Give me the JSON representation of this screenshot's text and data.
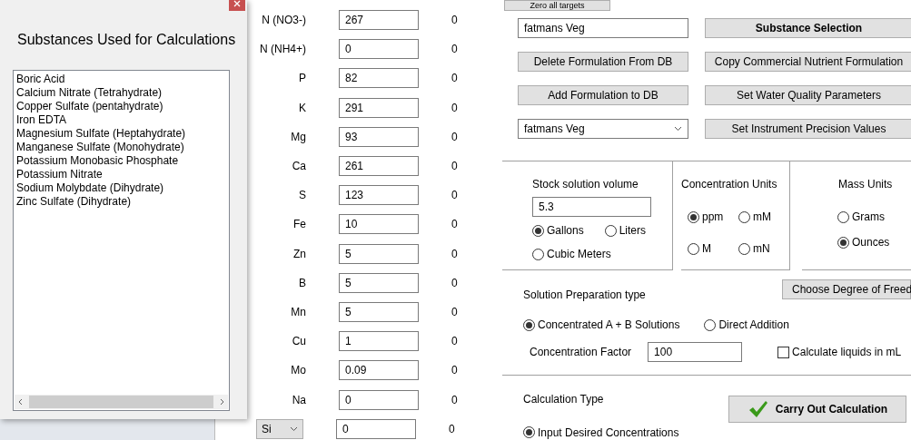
{
  "substances_dialog": {
    "title": "Substances Used for Calculations",
    "items": [
      "Boric Acid",
      "Calcium Nitrate (Tetrahydrate)",
      "Copper Sulfate (pentahydrate)",
      "Iron EDTA",
      "Magnesium Sulfate (Heptahydrate)",
      "Manganese Sulfate (Monohydrate)",
      "Potassium Monobasic Phosphate",
      "Potassium Nitrate",
      "Sodium Molybdate (Dihydrate)",
      "Zinc Sulfate (Dihydrate)"
    ]
  },
  "targets": [
    {
      "kind": "label",
      "label": "N (NO3-)",
      "value": "267",
      "result": "0"
    },
    {
      "kind": "label",
      "label": "N (NH4+)",
      "value": "0",
      "result": "0"
    },
    {
      "kind": "label",
      "label": "P",
      "value": "82",
      "result": "0"
    },
    {
      "kind": "label",
      "label": "K",
      "value": "291",
      "result": "0"
    },
    {
      "kind": "label",
      "label": "Mg",
      "value": "93",
      "result": "0"
    },
    {
      "kind": "label",
      "label": "Ca",
      "value": "261",
      "result": "0"
    },
    {
      "kind": "label",
      "label": "S",
      "value": "123",
      "result": "0"
    },
    {
      "kind": "label",
      "label": "Fe",
      "value": "10",
      "result": "0"
    },
    {
      "kind": "label",
      "label": "Zn",
      "value": "5",
      "result": "0"
    },
    {
      "kind": "label",
      "label": "B",
      "value": "5",
      "result": "0"
    },
    {
      "kind": "label",
      "label": "Mn",
      "value": "5",
      "result": "0"
    },
    {
      "kind": "label",
      "label": "Cu",
      "value": "1",
      "result": "0"
    },
    {
      "kind": "label",
      "label": "Mo",
      "value": "0.09",
      "result": "0"
    },
    {
      "kind": "label",
      "label": "Na",
      "value": "0",
      "result": "0"
    },
    {
      "kind": "select",
      "label": "Si",
      "value": "0",
      "result": "0"
    }
  ],
  "zero_button": "Zero all targets",
  "formulation_name": "fatmans Veg",
  "left_buttons": [
    "Delete Formulation From DB",
    "Add Formulation to DB"
  ],
  "formulation_select": "fatmans Veg",
  "right_buttons": [
    {
      "label": "Substance Selection",
      "bold": true
    },
    {
      "label": "Copy Commercial Nutrient Formulation",
      "bold": false
    },
    {
      "label": "Set Water Quality Parameters",
      "bold": false
    },
    {
      "label": "Set Instrument Precision Values",
      "bold": false
    }
  ],
  "stock": {
    "title": "Stock solution volume",
    "value": "5.3",
    "units": [
      {
        "label": "Gallons",
        "selected": true
      },
      {
        "label": "Liters",
        "selected": false
      },
      {
        "label": "Cubic Meters",
        "selected": false
      }
    ]
  },
  "concentration_units": {
    "title": "Concentration Units",
    "options": [
      {
        "label": "ppm",
        "selected": true
      },
      {
        "label": "mM",
        "selected": false
      },
      {
        "label": "M",
        "selected": false
      },
      {
        "label": "mN",
        "selected": false
      }
    ]
  },
  "mass_units": {
    "title": "Mass Units",
    "options": [
      {
        "label": "Grams",
        "selected": false
      },
      {
        "label": "Ounces",
        "selected": true
      }
    ]
  },
  "preparation": {
    "title": "Solution Preparation type",
    "dof_button": "Choose Degree of Freed",
    "options": [
      {
        "label": "Concentrated A + B Solutions",
        "selected": true
      },
      {
        "label": "Direct Addition",
        "selected": false
      }
    ],
    "factor_label": "Concentration Factor",
    "factor_value": "100",
    "liquids_ml": {
      "label": "Calculate liquids in mL",
      "checked": false
    }
  },
  "calculation": {
    "title": "Calculation Type",
    "button": "Carry Out Calculation",
    "options": [
      {
        "label": "Input Desired Concentrations",
        "selected": true
      }
    ]
  }
}
